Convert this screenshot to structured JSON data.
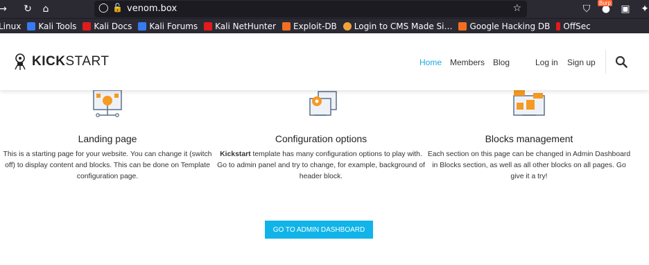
{
  "browser": {
    "url": "venom.box",
    "burp_label": "Burp",
    "bookmarks": [
      {
        "label": "Linux",
        "color": "#2b2a33"
      },
      {
        "label": "Kali Tools",
        "color": "#367bf0"
      },
      {
        "label": "Kali Docs",
        "color": "#e21b1b"
      },
      {
        "label": "Kali Forums",
        "color": "#367bf0"
      },
      {
        "label": "Kali NetHunter",
        "color": "#e21b1b"
      },
      {
        "label": "Exploit-DB",
        "color": "#f26f21"
      },
      {
        "label": "Login to CMS Made Si…",
        "color": "#f2a23a"
      },
      {
        "label": "Google Hacking DB",
        "color": "#f26f21"
      },
      {
        "label": "OffSec",
        "color": "#e21b1b"
      }
    ]
  },
  "header": {
    "logo_bold": "KICK",
    "logo_light": "START",
    "nav": {
      "home": "Home",
      "members": "Members",
      "blog": "Blog",
      "login": "Log in",
      "signup": "Sign up"
    },
    "search_icon": "search-icon"
  },
  "features": [
    {
      "title": "Landing page",
      "text": "This is a starting page for your website. You can change it (switch off) to display content and blocks. This can be done on Template configuration page."
    },
    {
      "title": "Configuration options",
      "bold": "Kickstart",
      "text": " template has many configuration options to play with. Go to admin panel and try to change, for example, background of header block."
    },
    {
      "title": "Blocks management",
      "text": "Each section on this page can be changed in Admin Dashboard in Blocks section, as well as all other blocks on all pages. Go give it a try!"
    }
  ],
  "cta": "GO TO ADMIN DASHBOARD",
  "colors": {
    "accent": "#1ba8e0",
    "button": "#10b4e8",
    "illustration_orange": "#f59a23",
    "illustration_blue": "#5b6f8a"
  }
}
